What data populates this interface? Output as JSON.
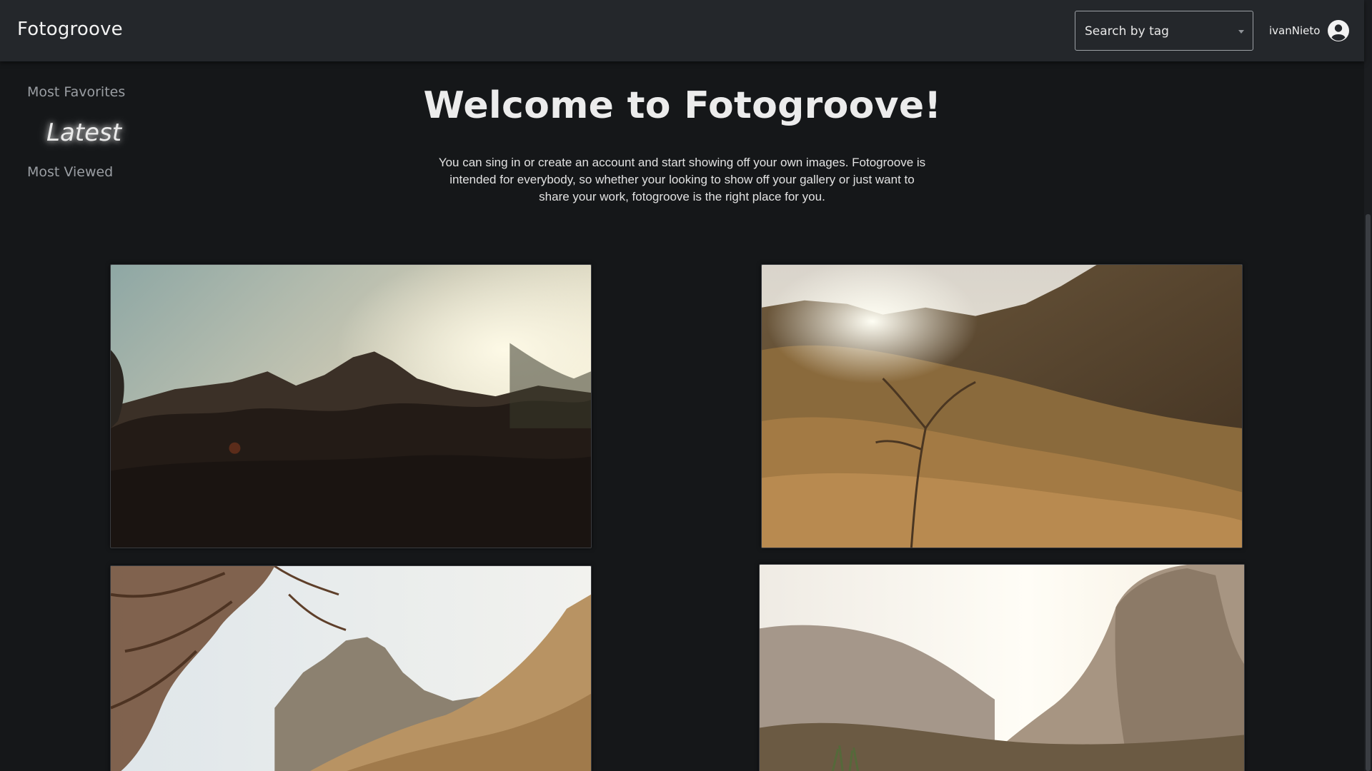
{
  "header": {
    "brand": "Fotogroove",
    "tag_search_placeholder": "Search by tag",
    "username": "ivanNieto",
    "avatar_icon": "account-circle-icon",
    "caret_icon": "chevron-down-icon"
  },
  "sidebar": {
    "items": [
      {
        "label": "Most Favorites",
        "active": false
      },
      {
        "label": "Latest",
        "active": true
      },
      {
        "label": "Most Viewed",
        "active": false
      }
    ]
  },
  "hero": {
    "title": "Welcome to Fotogroove!",
    "text": "You can sing in or create an account and start showing off your own images. Fotogroove is intended for everybody, so whether your looking to show off your gallery or just want to share your work, fotogroove is the right place for you."
  },
  "colors": {
    "background": "#151719",
    "header": "#24272b",
    "text": "#e6e6e6",
    "muted": "#9a9ea3"
  }
}
